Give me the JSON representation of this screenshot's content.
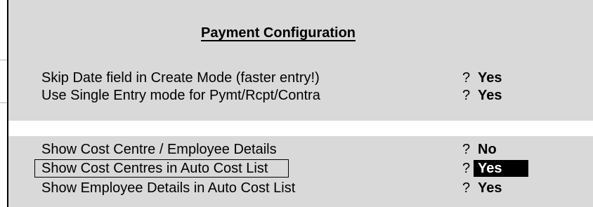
{
  "dialog": {
    "title": "Payment Configuration",
    "group1": [
      {
        "label": "Skip Date field in Create Mode (faster entry!)",
        "q": "?",
        "value": "Yes"
      },
      {
        "label": "Use Single Entry mode for Pymt/Rcpt/Contra",
        "q": "?",
        "value": "Yes"
      }
    ],
    "group2": [
      {
        "label": "Show Cost Centre / Employee Details",
        "q": "?",
        "value": "No"
      },
      {
        "label": "Show Cost Centres in Auto Cost List",
        "q": "?",
        "value": "Yes"
      },
      {
        "label": "Show Employee Details in Auto Cost List",
        "q": "?",
        "value": "Yes"
      }
    ]
  }
}
